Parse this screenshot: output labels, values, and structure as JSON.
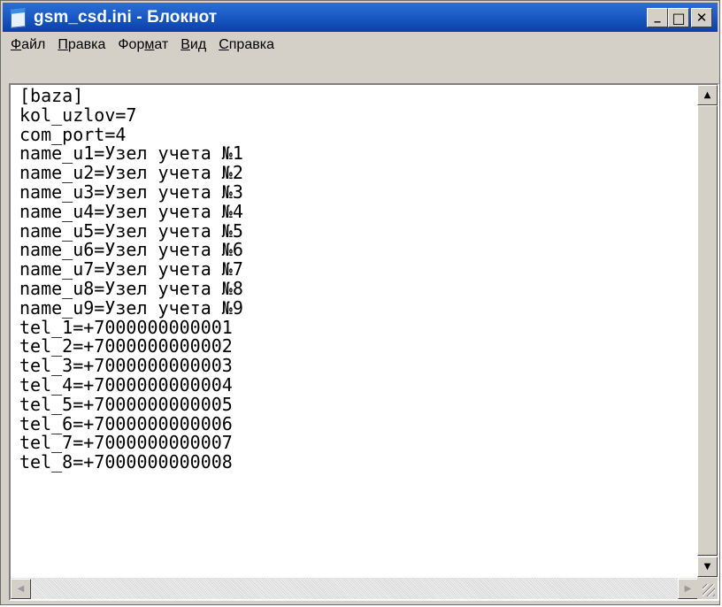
{
  "window": {
    "title": "gsm_csd.ini - Блокнот"
  },
  "title_controls": {
    "minimize": "_",
    "maximize": "□",
    "close": "✕"
  },
  "menu": {
    "file": {
      "hotkey": "Ф",
      "rest": "айл"
    },
    "edit": {
      "hotkey": "П",
      "rest": "равка"
    },
    "format": {
      "pre": "Фор",
      "hotkey": "м",
      "rest": "ат"
    },
    "view": {
      "hotkey": "В",
      "rest": "ид"
    },
    "help": {
      "hotkey": "С",
      "rest": "правка"
    }
  },
  "editor": {
    "content": "[baza]\nkol_uzlov=7\ncom_port=4\nname_u1=Узел учета №1\nname_u2=Узел учета №2\nname_u3=Узел учета №3\nname_u4=Узел учета №4\nname_u5=Узел учета №5\nname_u6=Узел учета №6\nname_u7=Узел учета №7\nname_u8=Узел учета №8\nname_u9=Узел учета №9\ntel_1=+7000000000001\ntel_2=+7000000000002\ntel_3=+7000000000003\ntel_4=+7000000000004\ntel_5=+7000000000005\ntel_6=+7000000000006\ntel_7=+7000000000007\ntel_8=+7000000000008"
  },
  "icons": {
    "app": "notepad-icon",
    "scroll_up": "▲",
    "scroll_down": "▼",
    "scroll_left": "◀",
    "scroll_right": "▶"
  }
}
